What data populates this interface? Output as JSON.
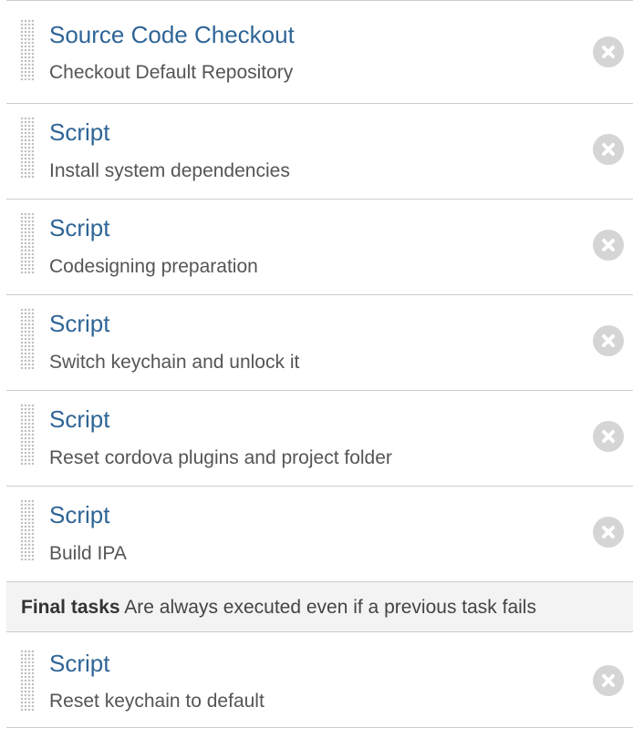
{
  "tasks": [
    {
      "title": "Source Code Checkout",
      "description": "Checkout Default Repository"
    },
    {
      "title": "Script",
      "description": "Install system dependencies"
    },
    {
      "title": "Script",
      "description": "Codesigning preparation"
    },
    {
      "title": "Script",
      "description": "Switch keychain and unlock it"
    },
    {
      "title": "Script",
      "description": "Reset cordova plugins and project folder"
    },
    {
      "title": "Script",
      "description": "Build IPA"
    }
  ],
  "final_section": {
    "title": "Final tasks",
    "note": "Are always executed even if a previous task fails"
  },
  "final_tasks": [
    {
      "title": "Script",
      "description": "Reset keychain to default"
    }
  ],
  "icons": {
    "drag": "drag-handle-icon",
    "remove": "remove-circle-x-icon"
  },
  "colors": {
    "title": "#2f6596",
    "description": "#555555",
    "remove_button": "#d5d5d5",
    "section_background": "#f3f3f3"
  }
}
